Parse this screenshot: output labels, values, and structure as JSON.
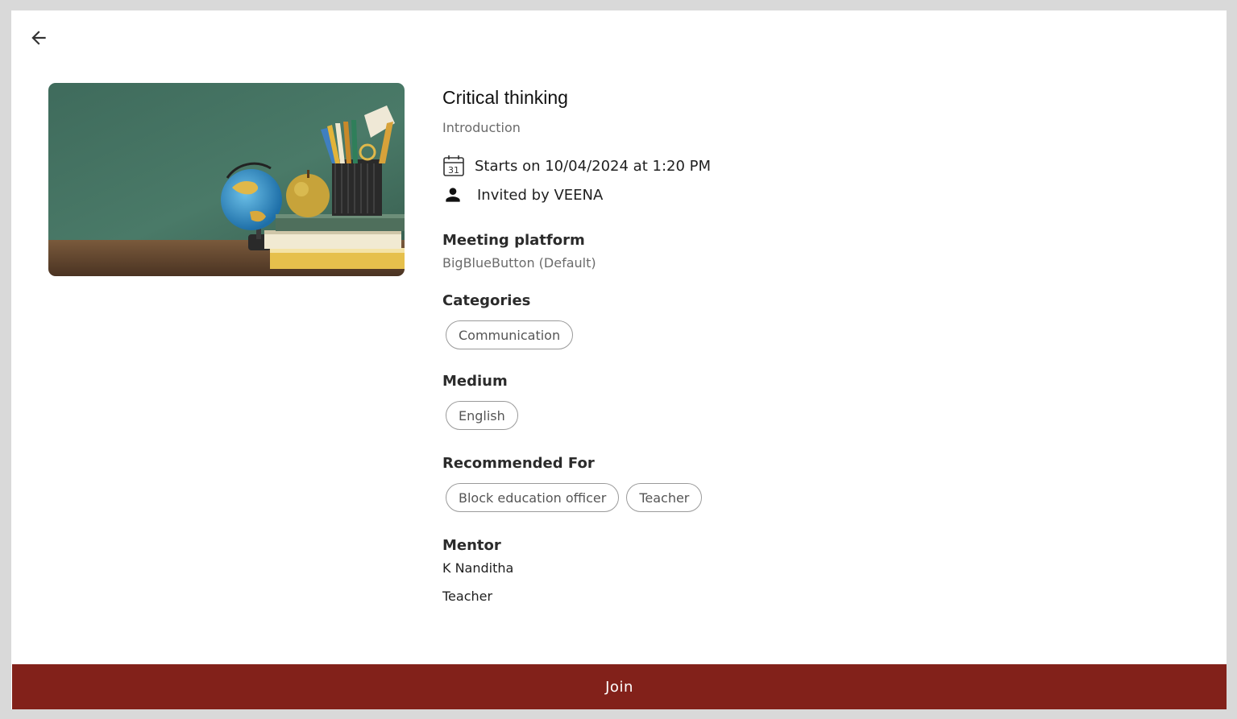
{
  "session": {
    "title": "Critical thinking",
    "subtitle": "Introduction",
    "start_text": "Starts on 10/04/2024 at 1:20 PM",
    "calendar_day": "31",
    "invited_text": "Invited by VEENA"
  },
  "platform": {
    "heading": "Meeting platform",
    "value": "BigBlueButton (Default)"
  },
  "categories": {
    "heading": "Categories",
    "items": [
      "Communication"
    ]
  },
  "medium": {
    "heading": "Medium",
    "items": [
      "English"
    ]
  },
  "recommended": {
    "heading": "Recommended For",
    "items": [
      "Block education officer",
      "Teacher"
    ]
  },
  "mentor": {
    "heading": "Mentor",
    "name": "K Nanditha",
    "role": "Teacher"
  },
  "actions": {
    "join_label": "Join"
  },
  "icons": {
    "back": "arrow-left-icon",
    "calendar": "calendar-icon",
    "person": "person-icon"
  },
  "colors": {
    "primary": "#82211a",
    "page_bg": "#d9d9d9",
    "chip_border": "#9a9a9a"
  }
}
